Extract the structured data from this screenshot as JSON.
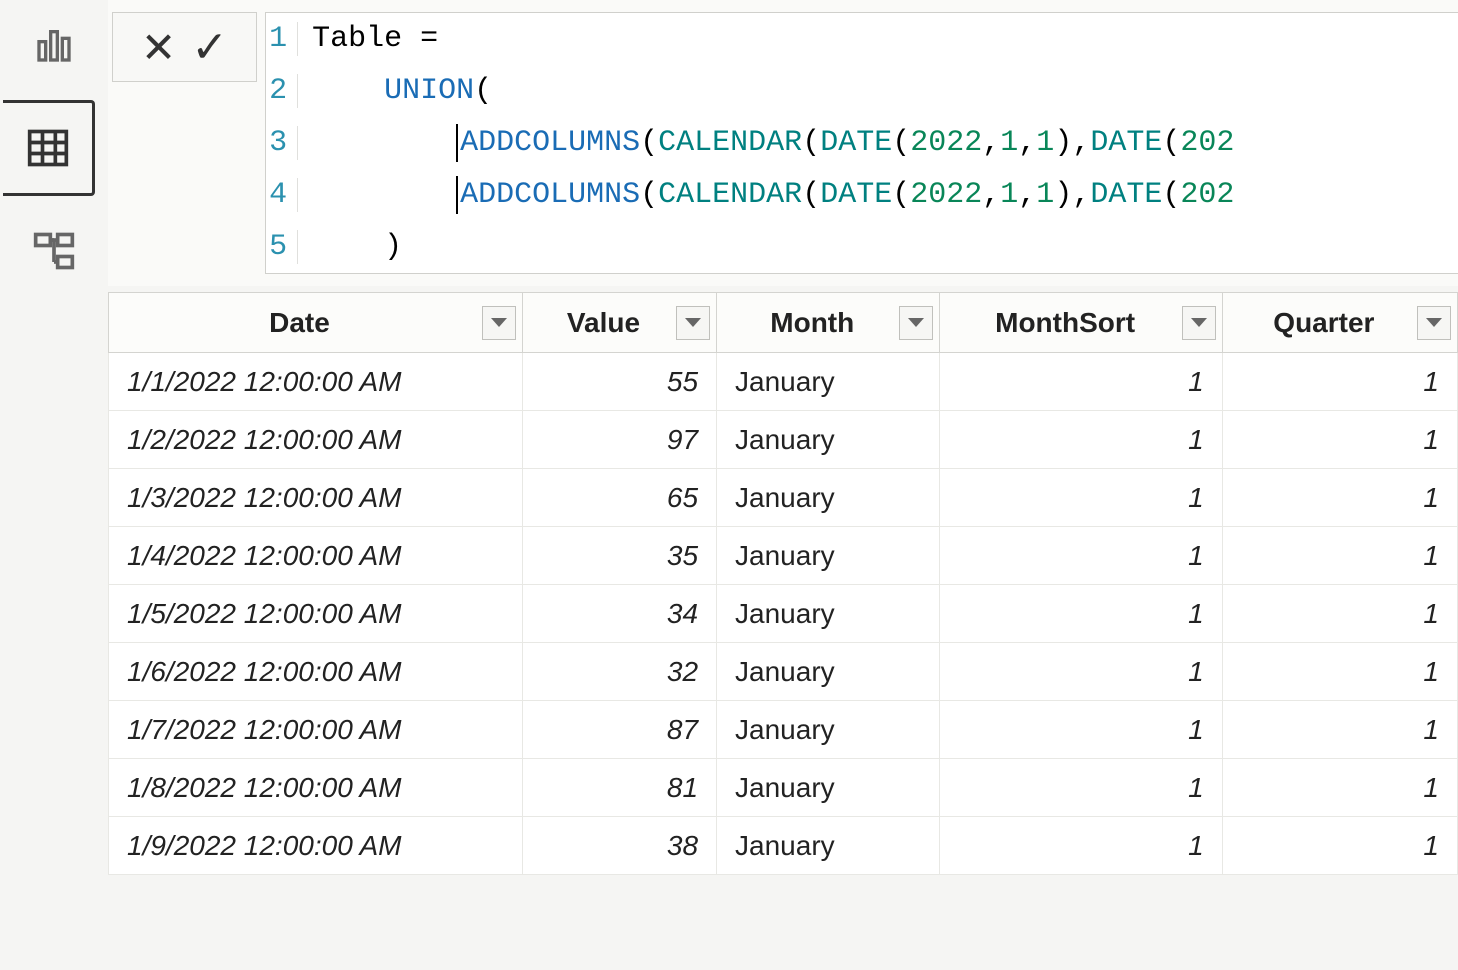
{
  "rail": {
    "report_icon": "report-icon",
    "data_icon": "data-icon",
    "model_icon": "model-icon"
  },
  "formula_bar": {
    "cancel_symbol": "✕",
    "confirm_symbol": "✓",
    "lines": {
      "l1": "Table =",
      "l2_pre": "    ",
      "l2_fn": "UNION",
      "l2_paren": "(",
      "l3_pre": "        ",
      "l3_fn1": "ADDCOLUMNS",
      "l3_paren1": "(",
      "l3_fn2": "CALENDAR",
      "l3_paren2": "(",
      "l3_fn3": "DATE",
      "l3_paren3": "(",
      "l3_n1": "2022",
      "l3_c1": ",",
      "l3_n2": "1",
      "l3_c2": ",",
      "l3_n3": "1",
      "l3_paren4": "),",
      "l3_fn4": "DATE",
      "l3_paren5": "(",
      "l3_n4": "202",
      "l4_pre": "        ",
      "l4_fn1": "ADDCOLUMNS",
      "l4_paren1": "(",
      "l4_fn2": "CALENDAR",
      "l4_paren2": "(",
      "l4_fn3": "DATE",
      "l4_paren3": "(",
      "l4_n1": "2022",
      "l4_c1": ",",
      "l4_n2": "1",
      "l4_c2": ",",
      "l4_n3": "1",
      "l4_paren4": "),",
      "l4_fn4": "DATE",
      "l4_paren5": "(",
      "l4_n4": "202",
      "l5": "    )"
    },
    "line_numbers": {
      "n1": "1",
      "n2": "2",
      "n3": "3",
      "n4": "4",
      "n5": "5"
    }
  },
  "table": {
    "columns": {
      "date": "Date",
      "value": "Value",
      "month": "Month",
      "monthsort": "MonthSort",
      "quarter": "Quarter"
    },
    "rows": [
      {
        "date": "1/1/2022 12:00:00 AM",
        "value": "55",
        "month": "January",
        "monthsort": "1",
        "quarter": "1"
      },
      {
        "date": "1/2/2022 12:00:00 AM",
        "value": "97",
        "month": "January",
        "monthsort": "1",
        "quarter": "1"
      },
      {
        "date": "1/3/2022 12:00:00 AM",
        "value": "65",
        "month": "January",
        "monthsort": "1",
        "quarter": "1"
      },
      {
        "date": "1/4/2022 12:00:00 AM",
        "value": "35",
        "month": "January",
        "monthsort": "1",
        "quarter": "1"
      },
      {
        "date": "1/5/2022 12:00:00 AM",
        "value": "34",
        "month": "January",
        "monthsort": "1",
        "quarter": "1"
      },
      {
        "date": "1/6/2022 12:00:00 AM",
        "value": "32",
        "month": "January",
        "monthsort": "1",
        "quarter": "1"
      },
      {
        "date": "1/7/2022 12:00:00 AM",
        "value": "87",
        "month": "January",
        "monthsort": "1",
        "quarter": "1"
      },
      {
        "date": "1/8/2022 12:00:00 AM",
        "value": "81",
        "month": "January",
        "monthsort": "1",
        "quarter": "1"
      },
      {
        "date": "1/9/2022 12:00:00 AM",
        "value": "38",
        "month": "January",
        "monthsort": "1",
        "quarter": "1"
      }
    ]
  }
}
